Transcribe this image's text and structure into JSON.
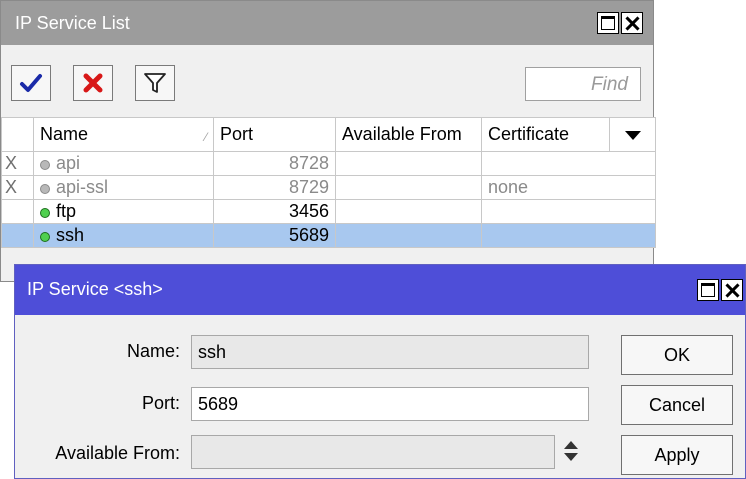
{
  "list_window": {
    "title": "IP Service List",
    "toolbar": {
      "enable_icon": "checkmark-icon",
      "disable_icon": "red-x-icon",
      "filter_icon": "funnel-icon",
      "find_placeholder": "Find"
    },
    "columns": {
      "name": "Name",
      "port": "Port",
      "available_from": "Available From",
      "certificate": "Certificate"
    },
    "rows": [
      {
        "flag": "X",
        "name": "api",
        "port": "8728",
        "available_from": "",
        "certificate": "",
        "status": "disabled"
      },
      {
        "flag": "X",
        "name": "api-ssl",
        "port": "8729",
        "available_from": "",
        "certificate": "none",
        "status": "disabled"
      },
      {
        "flag": "",
        "name": "ftp",
        "port": "3456",
        "available_from": "",
        "certificate": "",
        "status": "enabled"
      },
      {
        "flag": "",
        "name": "ssh",
        "port": "5689",
        "available_from": "",
        "certificate": "",
        "status": "selected"
      }
    ]
  },
  "dialog": {
    "title": "IP Service <ssh>",
    "name_label": "Name:",
    "name_value": "ssh",
    "port_label": "Port:",
    "port_value": "5689",
    "available_from_label": "Available From:",
    "available_from_value": "",
    "ok_label": "OK",
    "cancel_label": "Cancel",
    "apply_label": "Apply"
  },
  "colors": {
    "list_titlebar": "#9c9c9c",
    "dialog_titlebar": "#4e4ed8",
    "selected_row": "#a8c8ef",
    "enabled_dot": "#4fd04f"
  }
}
